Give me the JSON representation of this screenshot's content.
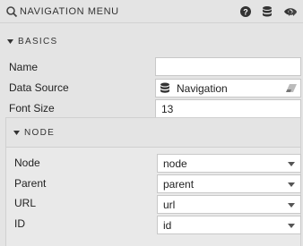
{
  "header": {
    "title": "NAVIGATION MENU",
    "icons": [
      "navigation-icon",
      "help-icon",
      "database-icon",
      "eye-icon",
      "double-chevron-right-icon"
    ]
  },
  "basics": {
    "title": "BASICS",
    "name_label": "Name",
    "name_value": "",
    "data_source_label": "Data Source",
    "data_source_value": "Navigation",
    "font_size_label": "Font Size",
    "font_size_value": "13"
  },
  "node_section": {
    "title": "NODE",
    "node_label": "Node",
    "node_value": "node",
    "parent_label": "Parent",
    "parent_value": "parent",
    "url_label": "URL",
    "url_value": "url",
    "id_label": "ID",
    "id_value": "id"
  },
  "colors": {
    "background": "#e4e4e4",
    "field_background": "#ffffff",
    "text": "#333333"
  }
}
